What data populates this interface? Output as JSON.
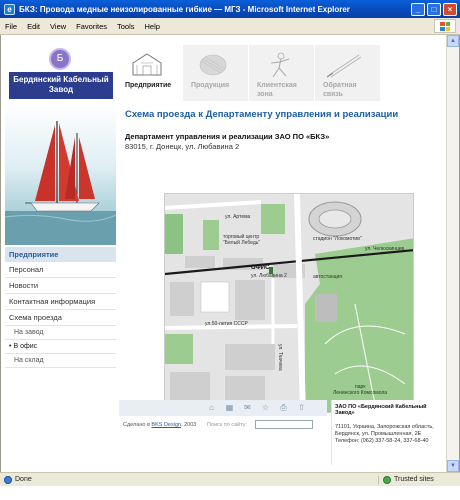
{
  "window": {
    "title": "БКЗ: Провода медные неизолированные гибкие — МГЗ - Microsoft Internet Explorer",
    "minimize": "_",
    "maximize": "□",
    "close": "×"
  },
  "menu": [
    "File",
    "Edit",
    "View",
    "Favorites",
    "Tools",
    "Help"
  ],
  "logo": {
    "line1": "Бердянский Кабельный",
    "line2": "Завод",
    "emblem": "Б"
  },
  "topnav": [
    {
      "label": "Предприятие",
      "active": true
    },
    {
      "label": "Продукция",
      "active": false
    },
    {
      "label": "Клиентская зона",
      "active": false
    },
    {
      "label": "Обратная связь",
      "active": false
    }
  ],
  "sidebar": {
    "head": "Предприятие",
    "items": [
      "Персонал",
      "Новости",
      "Контактная информация",
      "Схема проезда"
    ],
    "subitems": [
      {
        "label": "На завод",
        "current": false
      },
      {
        "label": "В офис",
        "current": true
      },
      {
        "label": "На склад",
        "current": false
      }
    ]
  },
  "content": {
    "title": "Схема проезда к Департаменту управления и реализации",
    "org_name": "Департамент управления и реализации ЗАО ПО «БКЗ»",
    "address": "83015, г. Донецк, ул. Любавина 2"
  },
  "map": {
    "labels": {
      "artema": "ул. Артема",
      "tc": "торговый центр",
      "tc2": "\"Белый Лебедь\"",
      "stadium": "стадион \"Локомотив\"",
      "chelyuskin": "ул. Челюскинцев",
      "office": "ОФИС",
      "office_addr": "ул. Любавина 2",
      "autostation": "автостанция",
      "ussr": "ул.50-летия СССР",
      "park": "парк",
      "park2": "Ленинского Комсомола",
      "street_vert": "ул. Ткачева"
    }
  },
  "footer": {
    "credit_prefix": "Сделано в",
    "credit_link": "BKS Design",
    "credit_year": ", 2003",
    "search_label": "Поиск по сайту:",
    "company": "ЗАО ПО «Бердянский Кабельный Завод»",
    "addr1": "71101, Украина, Запорожская область,",
    "addr2": "Бердянск, ул. Промышленная, 2Е",
    "phone": "Телефон: (062) 337-58-24, 337-68-40",
    "icons": [
      "home-icon",
      "sitemap-icon",
      "mail-icon",
      "favorite-icon",
      "print-icon",
      "up-icon"
    ]
  },
  "status": {
    "text": "Done",
    "zone": "Trusted sites"
  }
}
